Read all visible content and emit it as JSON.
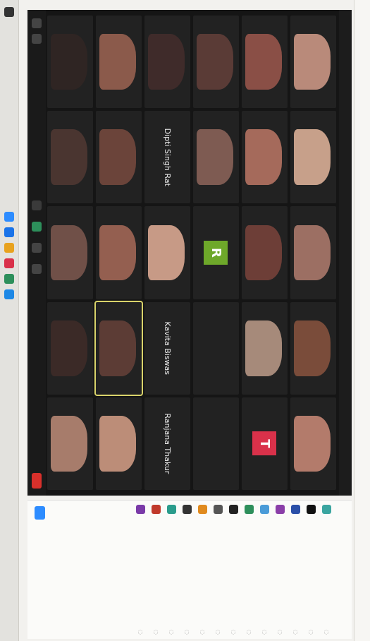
{
  "tiles": [
    {
      "kind": "photo",
      "color": "#b98a7a"
    },
    {
      "kind": "photo",
      "color": "#c7a08a"
    },
    {
      "kind": "photo",
      "color": "#9c6f63"
    },
    {
      "kind": "photo",
      "color": "#7a4c3a"
    },
    {
      "kind": "photo",
      "color": "#b37b6b"
    },
    {
      "kind": "photo",
      "color": "#8a4f46"
    },
    {
      "kind": "photo",
      "color": "#a56a5b"
    },
    {
      "kind": "photo",
      "color": "#6d3e37"
    },
    {
      "kind": "photo",
      "color": "#a68a7a"
    },
    {
      "kind": "avatar",
      "letter": "T",
      "color": "#d9314a"
    },
    {
      "kind": "photo",
      "color": "#5a3b36"
    },
    {
      "kind": "photo",
      "color": "#7e5b52"
    },
    {
      "kind": "avatar",
      "letter": "R",
      "color": "#6ea82a"
    },
    {
      "kind": "text",
      "name": ""
    },
    {
      "kind": "text",
      "name": ""
    },
    {
      "kind": "photo",
      "color": "#3f2b2a"
    },
    {
      "kind": "text",
      "name": "Dipti Singh Rat"
    },
    {
      "kind": "photo",
      "color": "#c79a86"
    },
    {
      "kind": "text",
      "name": "Kavita Biswas"
    },
    {
      "kind": "text",
      "name": "Ranjana Thakur"
    },
    {
      "kind": "photo",
      "color": "#8b5a4b"
    },
    {
      "kind": "photo",
      "color": "#6b443a"
    },
    {
      "kind": "photo",
      "color": "#945f50"
    },
    {
      "kind": "photo",
      "color": "#5c3c35",
      "active": true
    },
    {
      "kind": "photo",
      "color": "#bc8d78"
    },
    {
      "kind": "photo",
      "color": "#2f2523"
    },
    {
      "kind": "photo",
      "color": "#4a3530"
    },
    {
      "kind": "photo",
      "color": "#705048"
    },
    {
      "kind": "photo",
      "color": "#3b2a27"
    },
    {
      "kind": "photo",
      "color": "#a77c6b"
    }
  ],
  "participants": [
    {
      "color": "#3aa5a0"
    },
    {
      "color": "#111111"
    },
    {
      "color": "#2a4fa8"
    },
    {
      "color": "#8a3ea8"
    },
    {
      "color": "#4a9bd8"
    },
    {
      "color": "#2d8f5b"
    },
    {
      "color": "#222222"
    },
    {
      "color": "#555555"
    },
    {
      "color": "#e08a1e"
    },
    {
      "color": "#333333"
    },
    {
      "color": "#2a9c8c"
    },
    {
      "color": "#c0392b"
    },
    {
      "color": "#7a3aa8"
    }
  ],
  "taskbar_icons": [
    "#2d8cff",
    "#1a73e8",
    "#e8a21e",
    "#d9314a",
    "#2d8f5b",
    "#1e88e5"
  ]
}
